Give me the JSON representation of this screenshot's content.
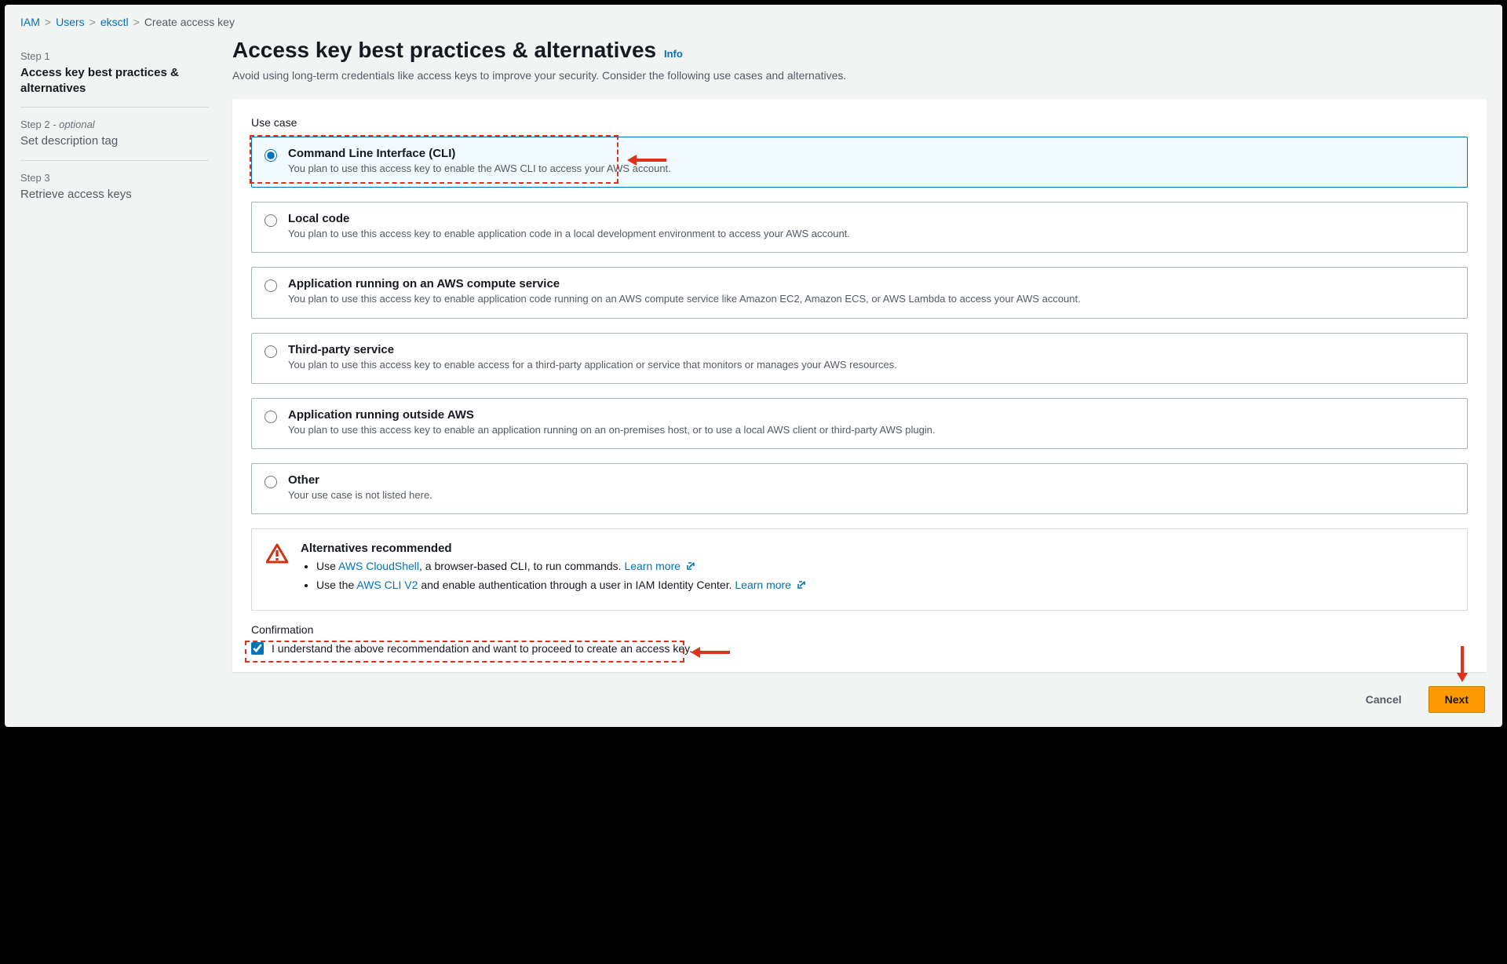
{
  "breadcrumb": {
    "items": [
      "IAM",
      "Users",
      "eksctl"
    ],
    "current": "Create access key"
  },
  "sidebar": {
    "steps": [
      {
        "label": "Step 1",
        "optional": "",
        "title": "Access key best practices & alternatives",
        "active": true
      },
      {
        "label": "Step 2",
        "optional": " - optional",
        "title": "Set description tag",
        "active": false
      },
      {
        "label": "Step 3",
        "optional": "",
        "title": "Retrieve access keys",
        "active": false
      }
    ]
  },
  "header": {
    "title": "Access key best practices & alternatives",
    "info": "Info",
    "subtitle": "Avoid using long-term credentials like access keys to improve your security. Consider the following use cases and alternatives."
  },
  "usecase": {
    "label": "Use case",
    "options": [
      {
        "title": "Command Line Interface (CLI)",
        "desc": "You plan to use this access key to enable the AWS CLI to access your AWS account.",
        "selected": true
      },
      {
        "title": "Local code",
        "desc": "You plan to use this access key to enable application code in a local development environment to access your AWS account.",
        "selected": false
      },
      {
        "title": "Application running on an AWS compute service",
        "desc": "You plan to use this access key to enable application code running on an AWS compute service like Amazon EC2, Amazon ECS, or AWS Lambda to access your AWS account.",
        "selected": false
      },
      {
        "title": "Third-party service",
        "desc": "You plan to use this access key to enable access for a third-party application or service that monitors or manages your AWS resources.",
        "selected": false
      },
      {
        "title": "Application running outside AWS",
        "desc": "You plan to use this access key to enable an application running on an on-premises host, or to use a local AWS client or third-party AWS plugin.",
        "selected": false
      },
      {
        "title": "Other",
        "desc": "Your use case is not listed here.",
        "selected": false
      }
    ]
  },
  "alternatives": {
    "title": "Alternatives recommended",
    "bullet1_pre": "Use ",
    "bullet1_link": "AWS CloudShell",
    "bullet1_post": ", a browser-based CLI, to run commands. ",
    "bullet2_pre": "Use the ",
    "bullet2_link": "AWS CLI V2",
    "bullet2_post": " and enable authentication through a user in IAM Identity Center. ",
    "learn_more": "Learn more"
  },
  "confirmation": {
    "label": "Confirmation",
    "text": "I understand the above recommendation and want to proceed to create an access key.",
    "checked": true
  },
  "footer": {
    "cancel": "Cancel",
    "next": "Next"
  }
}
